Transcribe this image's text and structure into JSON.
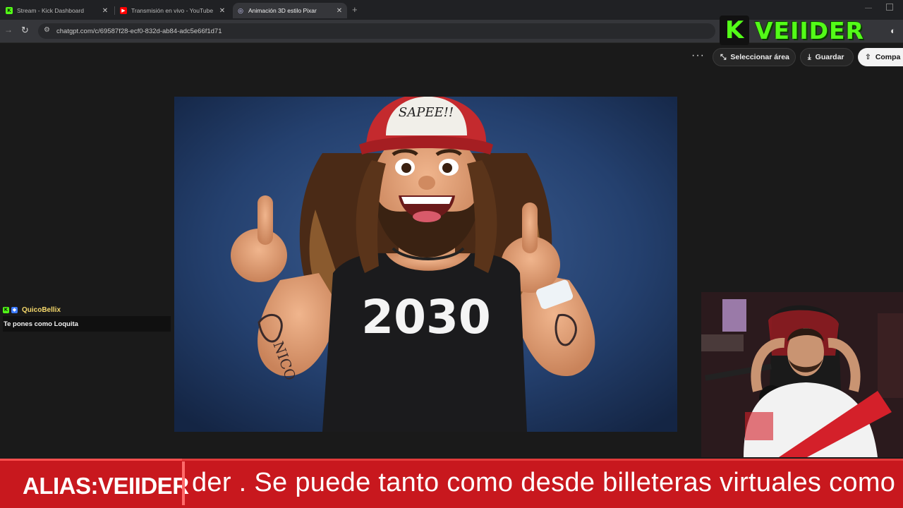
{
  "browser": {
    "tabs": [
      {
        "label": "Stream - Kick Dashboard",
        "icon": "kick-icon",
        "active": false
      },
      {
        "label": "Transmisión en vivo - YouTube",
        "icon": "youtube-icon",
        "active": false
      },
      {
        "label": "Animación 3D estilo Pixar",
        "icon": "chatgpt-icon",
        "active": true
      }
    ],
    "new_tab": "+",
    "url": "chatgpt.com/c/69587f28-ecf0-832d-ab84-adc5e66f1d71"
  },
  "toolbar": {
    "more_label": "···",
    "select_area_label": "Seleccionar área",
    "save_label": "Guardar",
    "share_label": "Compa"
  },
  "image": {
    "cap_text": "SAPEE!!",
    "shirt_text": "2030",
    "tattoo_text": "NICO"
  },
  "overlay": {
    "kick_letter": "K",
    "channel_name": "VEIIDER",
    "accent_color": "#53fc18"
  },
  "chat": {
    "username": "QuicoBellix",
    "message": "Te pones como Loquita"
  },
  "ticker": {
    "alias": "ALIAS:VEIIDER",
    "text": "der . Se puede tanto como desde billeteras virtuales como",
    "background": "#c8181e"
  }
}
